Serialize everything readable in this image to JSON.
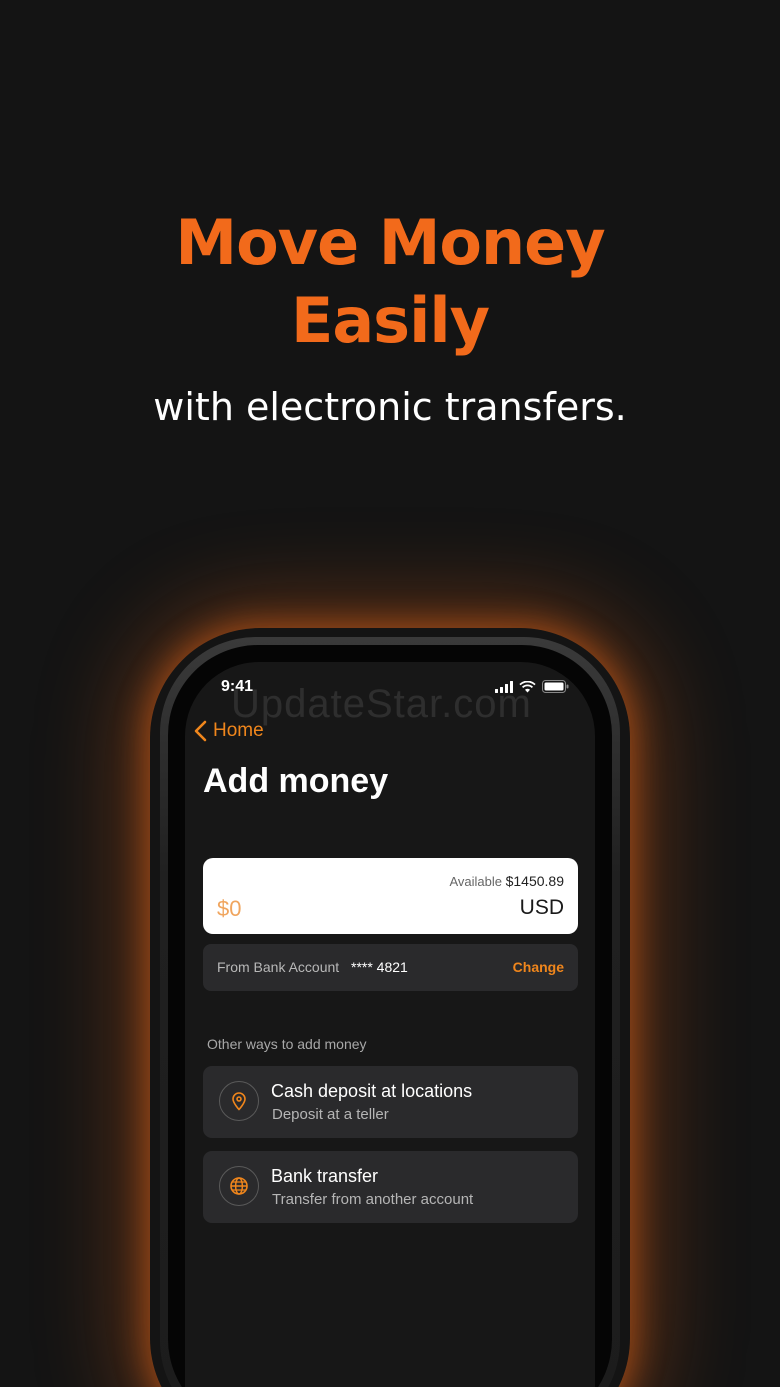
{
  "headline": {
    "line1": "Move Money",
    "line2": "Easily",
    "subtitle": "with electronic transfers."
  },
  "status_bar": {
    "time": "9:41"
  },
  "watermark": "UpdateStar.com",
  "nav": {
    "back_label": "Home"
  },
  "screen": {
    "title": "Add money"
  },
  "amount_card": {
    "available_label": "Available",
    "available_value": "$1450.89",
    "amount_placeholder": "$0",
    "currency": "USD"
  },
  "from_account": {
    "label": "From Bank Account",
    "account_number": "**** 4821",
    "change_label": "Change"
  },
  "other_ways": {
    "section_label": "Other ways to add money",
    "options": [
      {
        "title": "Cash deposit at locations",
        "subtitle": "Deposit at a teller",
        "icon": "location-pin-icon"
      },
      {
        "title": "Bank transfer",
        "subtitle": "Transfer from another account",
        "icon": "globe-icon"
      }
    ]
  },
  "colors": {
    "accent": "#f26a1b",
    "link": "#f0861c",
    "background": "#141414",
    "card": "#2a2a2c"
  }
}
